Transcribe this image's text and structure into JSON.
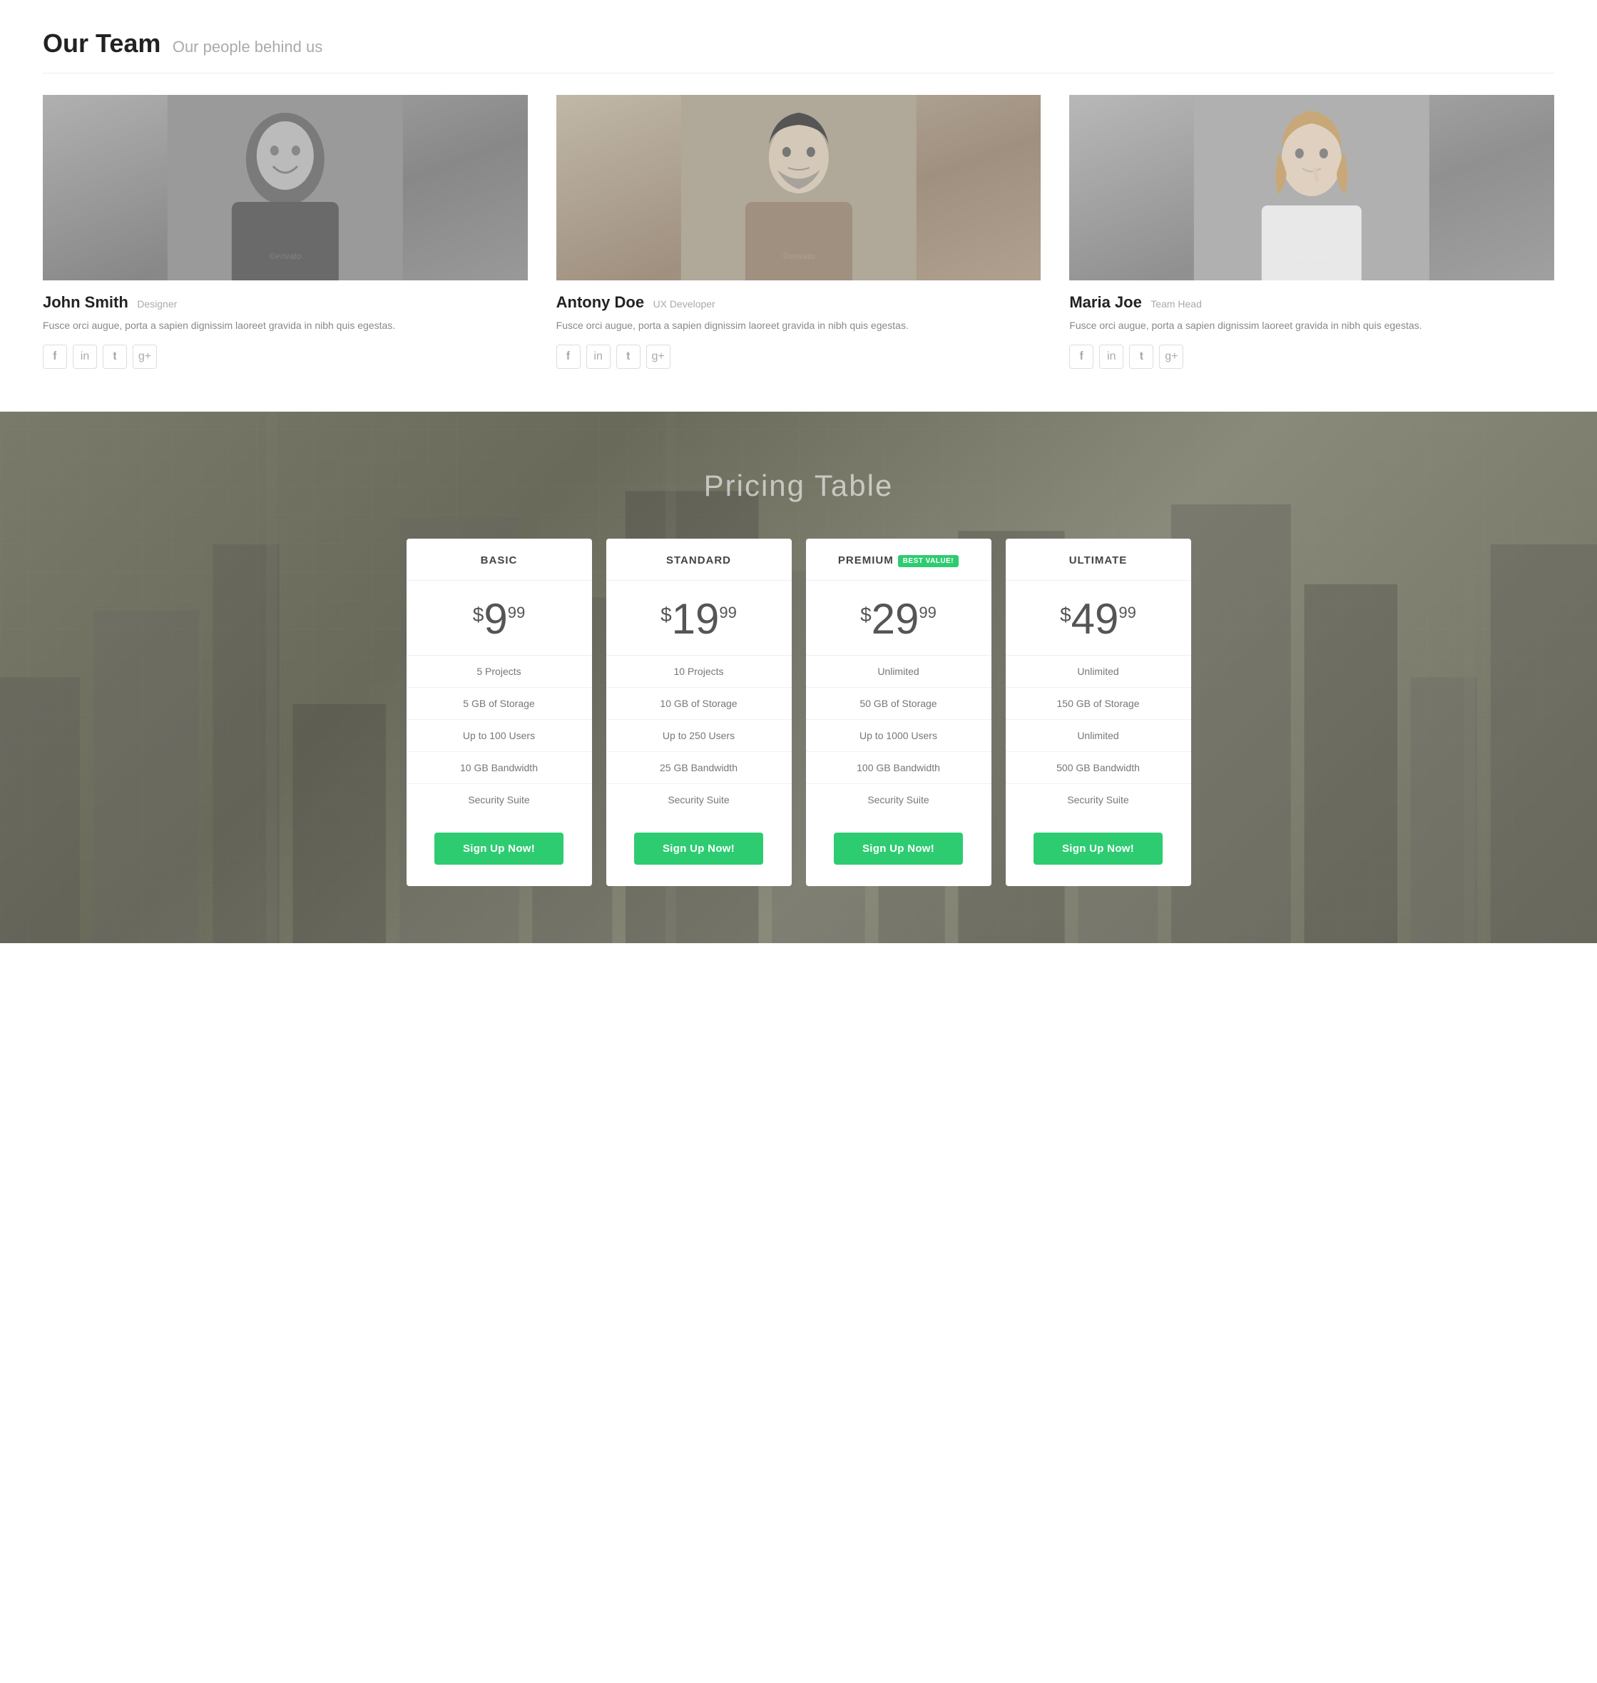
{
  "team": {
    "section_title": "Our Team",
    "section_subtitle": "Our people behind us",
    "members": [
      {
        "name": "John Smith",
        "role": "Designer",
        "bio": "Fusce orci augue, porta a sapien dignissim laoreet gravida in nibh quis egestas.",
        "photo_class": "photo-1",
        "social": [
          "f",
          "in",
          "t",
          "g+"
        ]
      },
      {
        "name": "Antony Doe",
        "role": "UX Developer",
        "bio": "Fusce orci augue, porta a sapien dignissim laoreet gravida in nibh quis egestas.",
        "photo_class": "photo-2",
        "social": [
          "f",
          "in",
          "t",
          "g+"
        ]
      },
      {
        "name": "Maria Joe",
        "role": "Team Head",
        "bio": "Fusce orci augue, porta a sapien dignissim laoreet gravida in nibh quis egestas.",
        "photo_class": "photo-3",
        "social": [
          "f",
          "in",
          "t",
          "g+"
        ]
      }
    ]
  },
  "pricing": {
    "section_title": "Pricing Table",
    "plans": [
      {
        "name": "BASIC",
        "best_value": false,
        "price_dollar": "$",
        "price_main": "9",
        "price_cents": "99",
        "features": [
          "5 Projects",
          "5 GB of Storage",
          "Up to 100 Users",
          "10 GB Bandwidth",
          "Security Suite"
        ],
        "button_label": "Sign Up Now!"
      },
      {
        "name": "STANDARD",
        "best_value": false,
        "price_dollar": "$",
        "price_main": "19",
        "price_cents": "99",
        "features": [
          "10 Projects",
          "10 GB of Storage",
          "Up to 250 Users",
          "25 GB Bandwidth",
          "Security Suite"
        ],
        "button_label": "Sign Up Now!"
      },
      {
        "name": "PREMIUM",
        "best_value": true,
        "best_value_label": "BEST VALUE!",
        "price_dollar": "$",
        "price_main": "29",
        "price_cents": "99",
        "features": [
          "Unlimited",
          "50 GB of Storage",
          "Up to 1000 Users",
          "100 GB Bandwidth",
          "Security Suite"
        ],
        "button_label": "Sign Up Now!"
      },
      {
        "name": "ULTIMATE",
        "best_value": false,
        "price_dollar": "$",
        "price_main": "49",
        "price_cents": "99",
        "features": [
          "Unlimited",
          "150 GB of Storage",
          "Unlimited",
          "500 GB Bandwidth",
          "Security Suite"
        ],
        "button_label": "Sign Up Now!"
      }
    ]
  }
}
